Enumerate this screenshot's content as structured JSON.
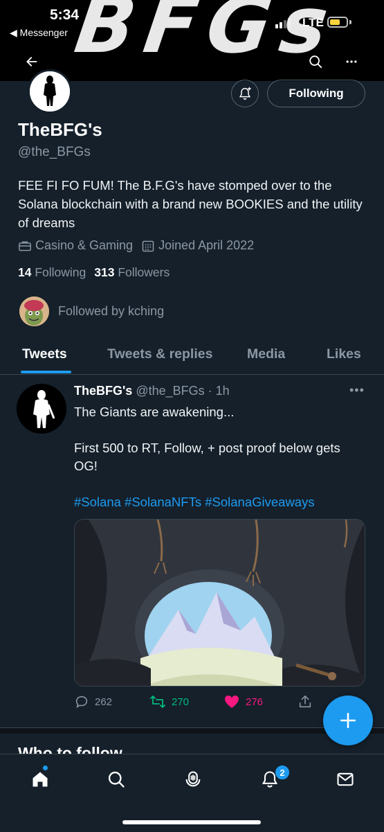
{
  "status_bar": {
    "time": "5:34",
    "back_app": "◀ Messenger",
    "network": "LTE",
    "banner_art": "BFGs"
  },
  "profile": {
    "name": "TheBFG's",
    "handle": "@the_BFGs",
    "bio": "FEE FI FO FUM! The B.F.G's have stomped over to the Solana blockchain with a brand new BOOKIES and the utility of dreams",
    "category": "Casino & Gaming",
    "joined": "Joined April 2022",
    "following_count": "14",
    "following_label": "Following",
    "followers_count": "313",
    "followers_label": "Followers",
    "followed_by": "Followed by kching",
    "follow_button": "Following"
  },
  "tabs": [
    {
      "label": "Tweets",
      "active": true
    },
    {
      "label": "Tweets & replies",
      "active": false
    },
    {
      "label": "Media",
      "active": false
    },
    {
      "label": "Likes",
      "active": false
    }
  ],
  "tweet": {
    "author": "TheBFG's",
    "handle_time": "@the_BFGs · 1h",
    "line1": "The Giants are awakening...",
    "line2": "First 500 to RT, Follow, + post proof below gets OG!",
    "hashtags": "#Solana #SolanaNFTs #SolanaGiveaways",
    "replies": "262",
    "retweets": "270",
    "likes": "276"
  },
  "who_to_follow": "Who to follow",
  "bottom_nav": {
    "notification_badge": "2"
  },
  "colors": {
    "background": "#15202b",
    "accent": "#1d9bf0",
    "retweet": "#00ba7c",
    "like": "#f91880",
    "muted": "#8b98a5"
  }
}
